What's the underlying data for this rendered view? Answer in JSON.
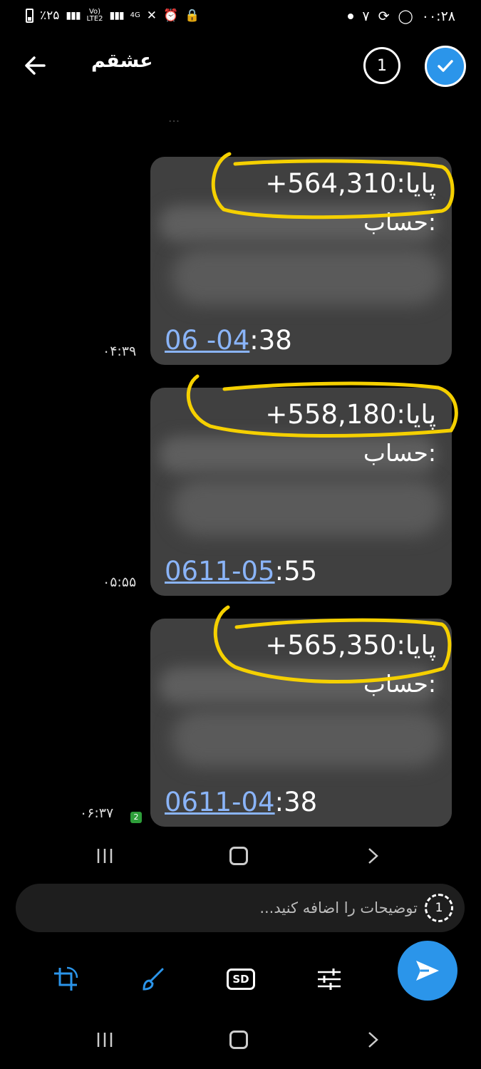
{
  "status_bar": {
    "battery": "٪۲۵",
    "network": "LTE2",
    "network_top": "Vo)",
    "data": "4G",
    "time": "۰۰:۲۸",
    "extra": "۷"
  },
  "header": {
    "title": "عشقم",
    "selected_count": "1"
  },
  "faded_text": "...",
  "messages": [
    {
      "balance": "+564,310:پایا",
      "account_label": "حساب:",
      "date_link": "06  -04",
      "date_rest": ":38",
      "time": "۰۴:۳۹"
    },
    {
      "balance": "+558,180:پایا",
      "account_label": "حساب:",
      "date_link": "0611-05",
      "date_rest": ":55",
      "time": "۰۵:۵۵"
    },
    {
      "balance": "+565,350:پایا",
      "account_label": "حساب:",
      "date_link": "0611-04",
      "date_rest": ":38",
      "time": "۰۶:۳۷",
      "badge": "2"
    }
  ],
  "caption": {
    "placeholder": "توضیحات را اضافه کنید...",
    "timer_label": "1"
  },
  "colors": {
    "accent": "#2b95ea",
    "bubble": "#404040",
    "highlight": "#f5d000",
    "link": "#8ab4f8"
  },
  "icons": [
    "back-arrow-icon",
    "check-icon",
    "crop-rotate-icon",
    "brush-icon",
    "sd-quality-icon",
    "adjust-icon",
    "send-icon",
    "nav-recent-icon",
    "nav-home-icon",
    "nav-back-icon",
    "timer-icon"
  ]
}
